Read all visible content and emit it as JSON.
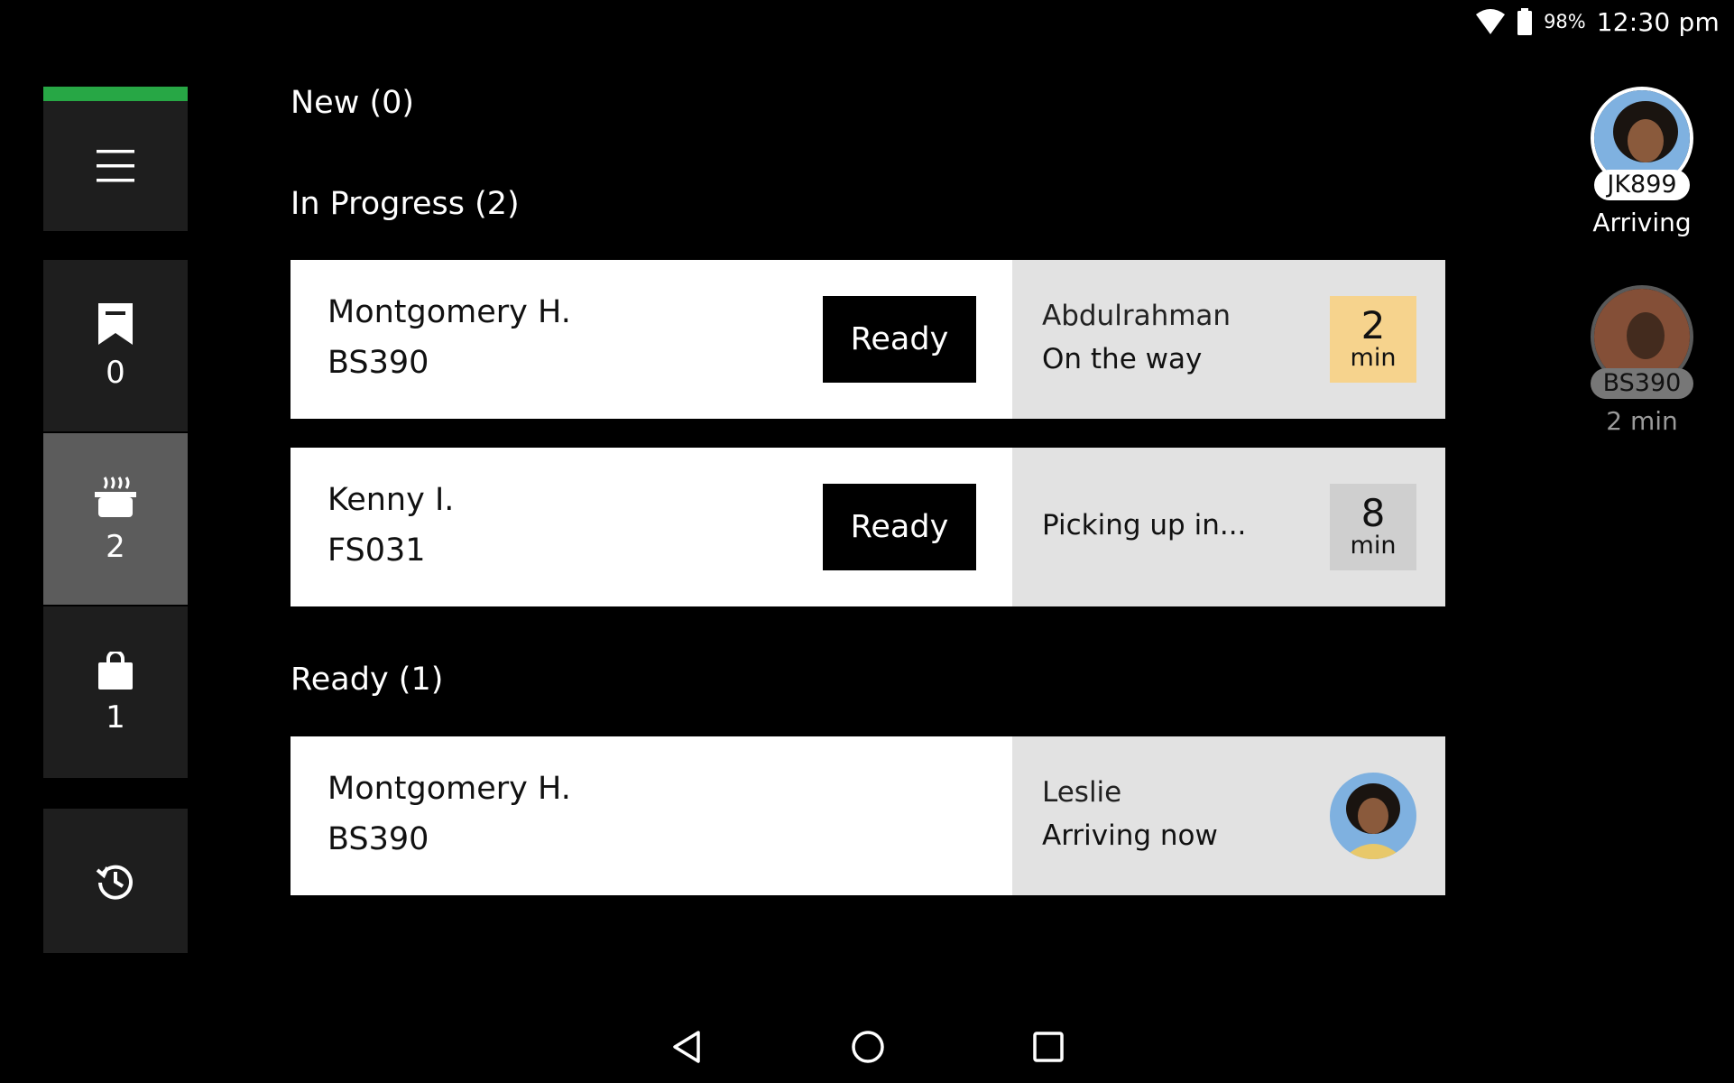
{
  "status_bar": {
    "battery_percent": "98%",
    "time": "12:30 pm",
    "icons": [
      "wifi-icon",
      "battery-icon"
    ]
  },
  "sidebar": {
    "accent_color": "#27a745",
    "menu_icon": "hamburger-icon",
    "items": [
      {
        "name": "new-orders",
        "icon": "receipt-icon",
        "count": "0"
      },
      {
        "name": "in-progress",
        "icon": "cooking-pot-icon",
        "count": "2",
        "active": true
      },
      {
        "name": "ready",
        "icon": "shopping-bag-icon",
        "count": "1"
      },
      {
        "name": "history",
        "icon": "history-icon"
      }
    ]
  },
  "sections": {
    "new_title": "New (0)",
    "in_progress_title": "In Progress (2)",
    "ready_title": "Ready (1)"
  },
  "in_progress_orders": [
    {
      "customer": "Montgomery H.",
      "code": "BS390",
      "action_label": "Ready",
      "driver_name": "Abdulrahman",
      "driver_status": "On the way",
      "eta_value": "2",
      "eta_unit": "min",
      "eta_color": "#f6d38d"
    },
    {
      "customer": "Kenny I.",
      "code": "FS031",
      "action_label": "Ready",
      "driver_status": "Picking up in...",
      "eta_value": "8",
      "eta_unit": "min",
      "eta_color": "#cfcfcf"
    }
  ],
  "ready_orders": [
    {
      "customer": "Montgomery H.",
      "code": "BS390",
      "driver_name": "Leslie",
      "driver_status": "Arriving now",
      "avatar_icon": "courier-avatar"
    }
  ],
  "couriers": [
    {
      "code": "JK899",
      "status": "Arriving"
    },
    {
      "code": "BS390",
      "status": "2 min"
    }
  ],
  "nav_bar": {
    "icons": [
      "back-icon",
      "home-icon",
      "recents-icon"
    ]
  }
}
